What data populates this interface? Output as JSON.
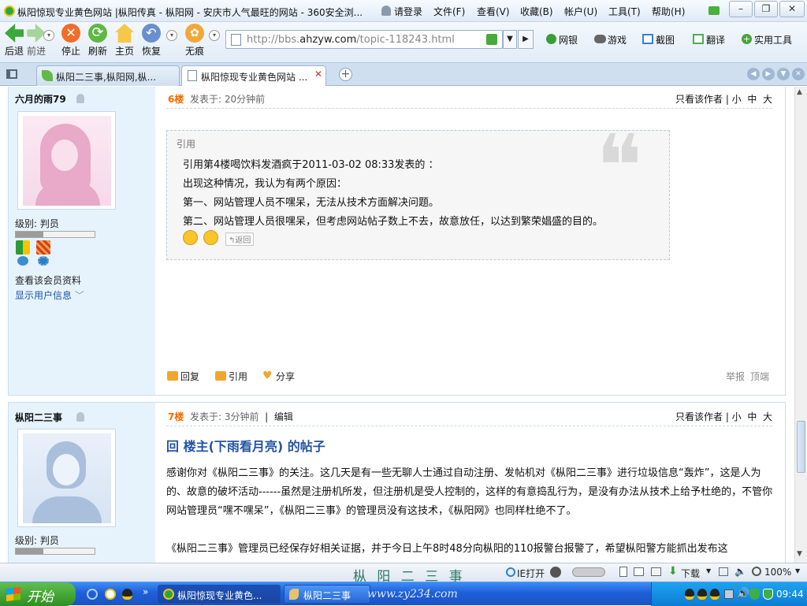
{
  "window": {
    "title": "枞阳惊现专业黄色网站 |枞阳传真 - 枞阳网 - 安庆市人气最旺的网站 - 360安全浏...",
    "menu": [
      "请登录",
      "文件(F)",
      "查看(V)",
      "收藏(B)",
      "帐户(U)",
      "工具(T)",
      "帮助(H)"
    ]
  },
  "toolbar": {
    "back": "后退",
    "forward": "前进",
    "stop": "停止",
    "refresh": "刷新",
    "home": "主页",
    "restore": "恢复",
    "incognito": "无痕",
    "url_prefix": "http://bbs.",
    "url_domain": "ahzyw.com",
    "url_path": "/topic-118243.html",
    "bank": "网银",
    "games": "游戏",
    "screenshot": "截图",
    "translate": "翻译",
    "tools": "实用工具"
  },
  "tabs": [
    {
      "label": "枞阳二三事,枞阳网,枞...",
      "active": false
    },
    {
      "label": "枞阳惊现专业黄色网站 ...",
      "active": true
    }
  ],
  "posts": [
    {
      "username": "六月的雨79",
      "level": "级别: 判员",
      "view_profile": "查看该会员资料",
      "show_info": "显示用户信息",
      "floor": "6楼",
      "posted": "发表于: 20分钟前",
      "only_author": "只看该作者",
      "size_options": [
        "小",
        "中",
        "大"
      ],
      "quote_label": "引用",
      "quote_lines": [
        "引用第4楼喝饮料发酒疯于2011-03-02 08:33发表的 ：",
        "出现这种情况，我认为有两个原因：",
        "第一、网站管理人员不嘿呆，无法从技术方面解决问题。",
        "第二、网站管理人员很嘿呆，但考虑网站帖子数上不去，故意放任，以达到繁荣娼盛的目的。"
      ],
      "return_label": "返回",
      "actions": [
        "回复",
        "引用",
        "分享"
      ],
      "report": "举报",
      "top": "顶端"
    },
    {
      "username": "枞阳二三事",
      "level": "级别: 判员",
      "floor": "7楼",
      "posted": "发表于: 3分钟前",
      "edit": "编辑",
      "only_author": "只看该作者",
      "size_options": [
        "小",
        "中",
        "大"
      ],
      "reply_title": "回  楼主(下雨看月亮) 的帖子",
      "paragraphs": [
        "感谢你对《枞阳二三事》的关注。这几天是有一些无聊人士通过自动注册、发帖机对《枞阳二三事》进行垃圾信息“轰炸”，这是人为的、故意的破坏活动------虽然是注册机所发，但注册机是受人控制的，这样的有意捣乱行为，是没有办法从技术上给予杜绝的，不管你网站管理员“嘿不嘿呆”，《枞阳二三事》的管理员没有这技术，《枞阳网》也同样杜绝不了。",
        "《枞阳二三事》管理员已经保存好相关证据，并于今日上午8时48分向枞阳的110报警台报警了，希望枞阳警方能抓出发布这"
      ]
    }
  ],
  "statusbar": {
    "watermark": "枞 阳 二 三 事",
    "watermark_url": "www.zy234.com",
    "ie_open": "IE打开",
    "download": "下载",
    "zoom": "100%"
  },
  "taskbar": {
    "start": "开始",
    "tasks": [
      "枞阳惊现专业黄色...",
      "枞阳二三事"
    ],
    "lang": "CH",
    "clock": "09:44"
  },
  "colors": {
    "accent": "#f26c00",
    "link": "#2255a4",
    "sidebar": "#e6f3fd"
  }
}
